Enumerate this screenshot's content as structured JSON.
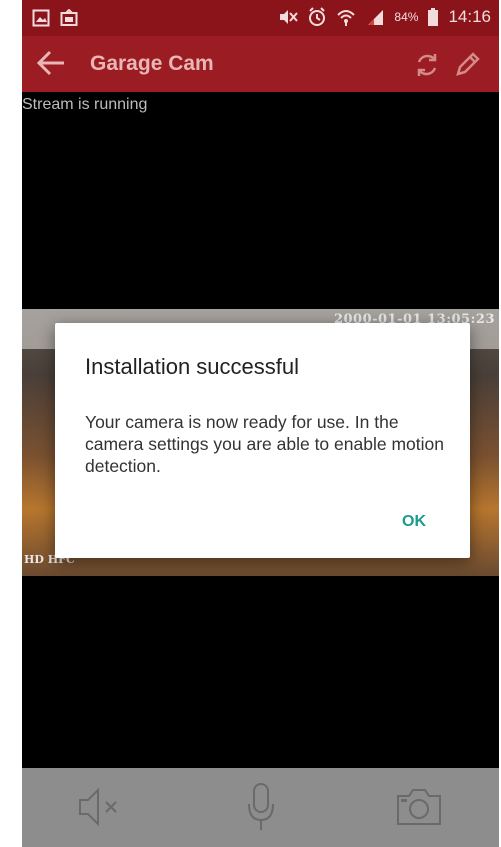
{
  "status_bar": {
    "battery_percent": "84%",
    "time": "14:16"
  },
  "app_bar": {
    "title": "Garage Cam"
  },
  "video": {
    "status_text": "Stream is running",
    "timestamp": "2000-01-01 13:05:23",
    "quality_label": "HD  HFC"
  },
  "dialog": {
    "title": "Installation successful",
    "message": "Your camera is now ready for use. In the camera settings you are able to enable motion detection.",
    "ok_label": "OK"
  },
  "colors": {
    "status_bar": "#8b141b",
    "app_bar": "#9b1c22",
    "accent": "#1a9b8c",
    "controls_bar": "#8d8d8d"
  },
  "icons": [
    "gallery-icon",
    "cast-icon",
    "mute-icon",
    "alarm-icon",
    "wifi-icon",
    "signal-icon",
    "battery-icon",
    "back-arrow-icon",
    "refresh-icon",
    "edit-pencil-icon",
    "speaker-mute-icon",
    "microphone-icon",
    "camera-icon"
  ]
}
